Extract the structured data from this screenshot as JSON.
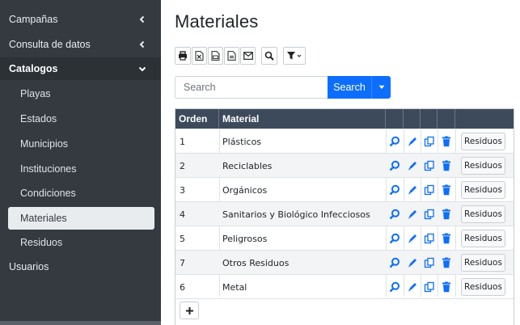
{
  "sidebar": {
    "items": [
      {
        "label": "Campañas"
      },
      {
        "label": "Consulta de datos"
      },
      {
        "label": "Catalogos"
      },
      {
        "label": "Usuarios"
      }
    ],
    "catalogos_sub": [
      {
        "label": "Playas"
      },
      {
        "label": "Estados"
      },
      {
        "label": "Municipios"
      },
      {
        "label": "Instituciones"
      },
      {
        "label": "Condiciones"
      },
      {
        "label": "Materiales"
      },
      {
        "label": "Residuos"
      }
    ],
    "active_item": "Materiales"
  },
  "main": {
    "title": "Materiales",
    "toolbar_icons": [
      "print-icon",
      "excel-icon",
      "csv-icon",
      "text-icon",
      "email-icon",
      "zoom-icon",
      "filter-icon"
    ],
    "search": {
      "placeholder": "Search",
      "button_label": "Search"
    },
    "table": {
      "columns": [
        "Orden",
        "Material"
      ],
      "rows": [
        {
          "orden": "1",
          "material": "Plásticos",
          "action": "Residuos"
        },
        {
          "orden": "2",
          "material": "Reciclables",
          "action": "Residuos"
        },
        {
          "orden": "3",
          "material": "Orgánicos",
          "action": "Residuos"
        },
        {
          "orden": "4",
          "material": "Sanitarios y Biológico Infecciosos",
          "action": "Residuos"
        },
        {
          "orden": "5",
          "material": "Peligrosos",
          "action": "Residuos"
        },
        {
          "orden": "7",
          "material": "Otros Residuos",
          "action": "Residuos"
        },
        {
          "orden": "6",
          "material": "Metal",
          "action": "Residuos"
        }
      ],
      "row_icons": [
        "search-icon",
        "edit-icon",
        "copy-icon",
        "delete-icon"
      ],
      "add_button": "+"
    }
  },
  "colors": {
    "sidebar_bg": "#343a40",
    "header_bg": "#3d4a5c",
    "primary": "#0d6efd",
    "delete": "#0d6efd"
  }
}
